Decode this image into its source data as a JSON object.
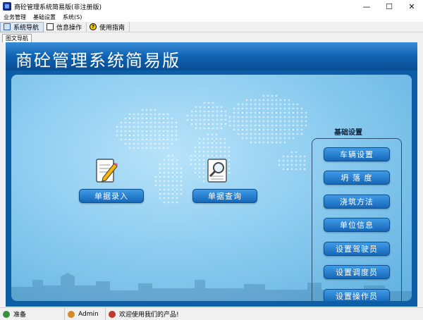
{
  "window": {
    "title": "商砼管理系统简易版(非注册版)",
    "minimize": "—",
    "maximize": "☐",
    "close": "✕"
  },
  "menu": [
    "业务管理",
    "基础设置",
    "系统(S)"
  ],
  "toolbar": {
    "items": [
      {
        "label": "系统导航",
        "icon": "navigation-icon"
      },
      {
        "label": "信息操作",
        "icon": "document-icon"
      },
      {
        "label": "使用指南",
        "icon": "help-icon"
      }
    ]
  },
  "tab": {
    "label": "图文导航"
  },
  "banner": {
    "title": "商砼管理系统简易版"
  },
  "actions": {
    "entry_label": "单据录入",
    "query_label": "单据查询"
  },
  "settings": {
    "title": "基础设置",
    "buttons": [
      "车辆设置",
      "坍 落 度",
      "浇筑方法",
      "单位信息",
      "设置驾驶员",
      "设置调度员",
      "设置操作员"
    ]
  },
  "status": {
    "state": "准备",
    "user": "Admin",
    "message": "欢迎使用我们的产品!"
  },
  "colors": {
    "banner": "#0f62b0",
    "panel": "#8ecdf0",
    "button": "#1667b8"
  }
}
